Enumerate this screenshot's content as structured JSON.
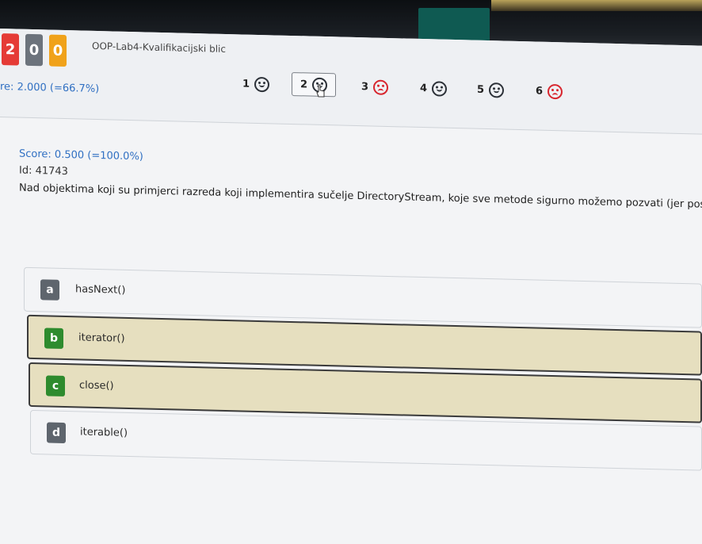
{
  "header": {
    "counters": [
      "2",
      "0",
      "0"
    ],
    "quiz_title": "OOP-Lab4-Kvalifikacijski blic",
    "total_score": "re: 2.000 (=66.7%)"
  },
  "question_nav": [
    {
      "number": "1",
      "status": "correct",
      "icon": "smiley-icon"
    },
    {
      "number": "2",
      "status": "correct",
      "icon": "smiley-icon",
      "current": true
    },
    {
      "number": "3",
      "status": "incorrect",
      "icon": "frown-icon"
    },
    {
      "number": "4",
      "status": "correct",
      "icon": "smiley-icon"
    },
    {
      "number": "5",
      "status": "correct",
      "icon": "smiley-icon"
    },
    {
      "number": "6",
      "status": "incorrect",
      "icon": "frown-icon"
    }
  ],
  "question": {
    "score": "Score: 0.500 (=100.0%)",
    "id": "Id: 41743",
    "text": "Nad objektima koji su primjerci razreda koji implementira sučelje DirectoryStream, koje sve metode sigurno možemo pozvati (jer postoje)?"
  },
  "answers": [
    {
      "letter": "a",
      "text": "hasNext()",
      "selected": false
    },
    {
      "letter": "b",
      "text": "iterator()",
      "selected": true
    },
    {
      "letter": "c",
      "text": "close()",
      "selected": true
    },
    {
      "letter": "d",
      "text": "iterable()",
      "selected": false
    }
  ],
  "colors": {
    "accent_blue": "#2f6fc2",
    "correct_green": "#2e8b2e",
    "incorrect_red": "#d8262e",
    "selected_bg": "#e6dfbf"
  }
}
